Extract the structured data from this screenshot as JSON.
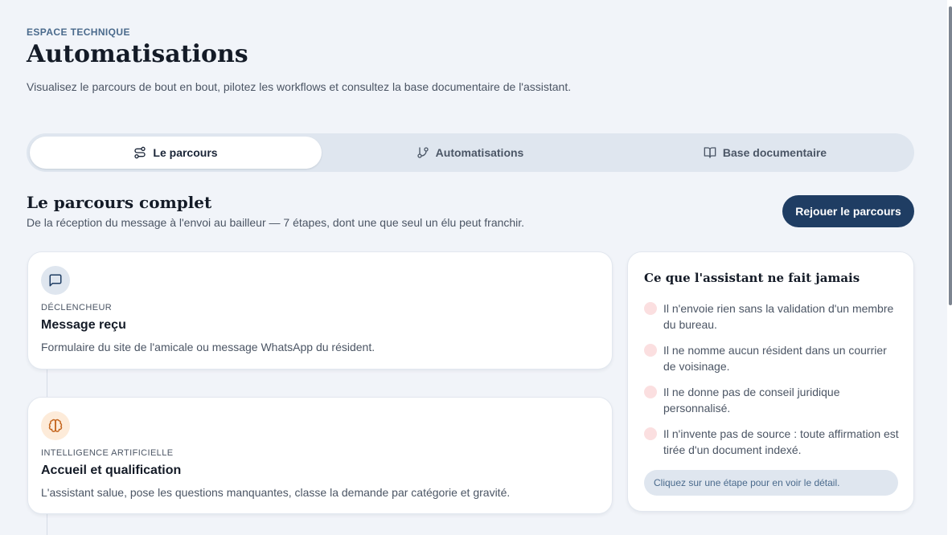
{
  "header": {
    "eyebrow": "ESPACE TECHNIQUE",
    "title": "Automatisations",
    "subtitle": "Visualisez le parcours de bout en bout, pilotez les workflows et consultez la base documentaire de l'assistant."
  },
  "tabs": [
    {
      "label": "Le parcours",
      "icon": "route-icon",
      "active": true
    },
    {
      "label": "Automatisations",
      "icon": "git-branch-icon",
      "active": false
    },
    {
      "label": "Base documentaire",
      "icon": "book-open-icon",
      "active": false
    }
  ],
  "section": {
    "title": "Le parcours complet",
    "subtitle": "De la réception du message à l'envoi au bailleur — 7 étapes, dont une que seul un élu peut franchir.",
    "replay_label": "Rejouer le parcours"
  },
  "steps": [
    {
      "icon": "message-square-icon",
      "kicker": "DÉCLENCHEUR",
      "title": "Message reçu",
      "description": "Formulaire du site de l'amicale ou message WhatsApp du résident."
    },
    {
      "icon": "brain-icon",
      "kicker": "INTELLIGENCE ARTIFICIELLE",
      "title": "Accueil et qualification",
      "description": "L'assistant salue, pose les questions manquantes, classe la demande par catégorie et gravité."
    }
  ],
  "side_panel": {
    "title": "Ce que l'assistant ne fait jamais",
    "rules": [
      "Il n'envoie rien sans la validation d'un membre du bureau.",
      "Il ne nomme aucun résident dans un courrier de voisinage.",
      "Il ne donne pas de conseil juridique personnalisé.",
      "Il n'invente pas de source : toute affirmation est tirée d'un document indexé."
    ],
    "hint": "Cliquez sur une étape pour en voir le détail."
  },
  "colors": {
    "background": "#f1f4f9",
    "accent": "#1f3d63",
    "message_icon_bg": "#dfe6ef",
    "brain_icon_bg": "#fdebd9",
    "rule_dot": "#fbdfe0"
  }
}
